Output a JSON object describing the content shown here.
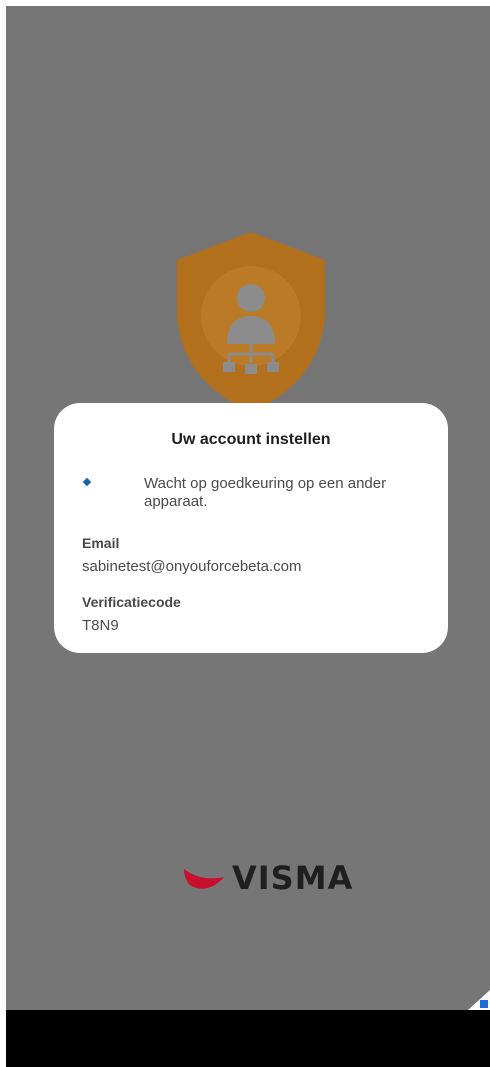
{
  "dialog": {
    "title": "Uw account instellen",
    "waiting_message": "Wacht op goedkeuring op een ander apparaat.",
    "email_label": "Email",
    "email_value": "sabinetest@onyouforcebeta.com",
    "code_label": "Verificatiecode",
    "code_value": "T8N9"
  },
  "branding": {
    "logo_text": "VISMA",
    "logo_color": "#c8102e"
  },
  "colors": {
    "overlay": "#767676",
    "shield": "#b3701c",
    "spinner": "#1565a8"
  },
  "icons": {
    "hero": "shield-user-network-icon",
    "spinner": "loading-spinner-icon",
    "corner": "corner-badge-icon"
  }
}
